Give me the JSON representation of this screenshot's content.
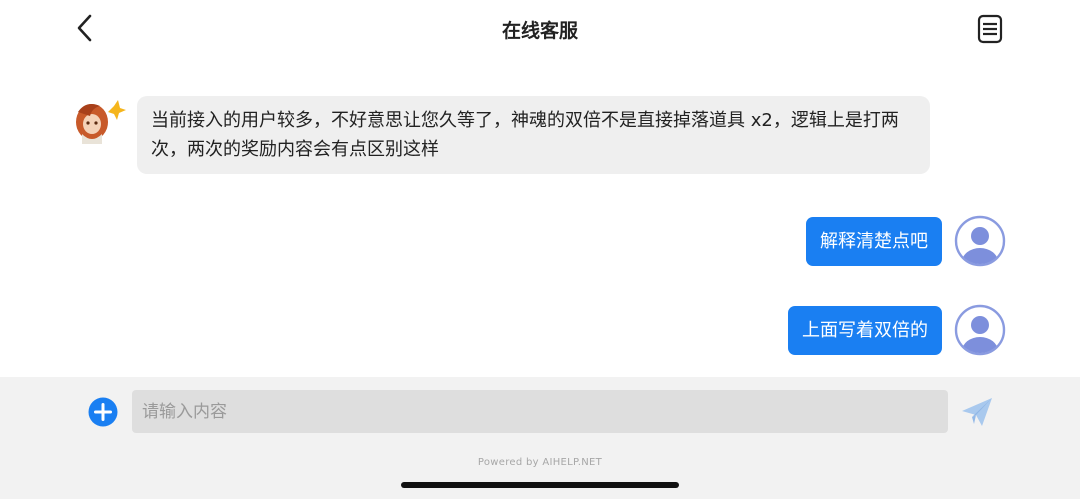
{
  "header": {
    "title": "在线客服",
    "back_icon": "chevron-left-icon",
    "menu_icon": "document-list-icon"
  },
  "messages": [
    {
      "sender": "agent",
      "text": "当前接入的用户较多，不好意思让您久等了，神魂的双倍不是直接掉落道具 x2，逻辑上是打两次，两次的奖励内容会有点区别这样"
    },
    {
      "sender": "user",
      "text": "解释清楚点吧"
    },
    {
      "sender": "user",
      "text": "上面写着双倍的"
    }
  ],
  "input": {
    "placeholder": "请输入内容",
    "value": ""
  },
  "footer": {
    "powered_by": "Powered by AIHELP.NET",
    "add_icon": "plus-circle-icon",
    "send_icon": "paper-plane-icon"
  },
  "colors": {
    "accent": "#1a7ff2",
    "agent_bubble": "#efefef",
    "input_bar": "#f2f2f2",
    "send_icon": "#a9c9ee"
  }
}
